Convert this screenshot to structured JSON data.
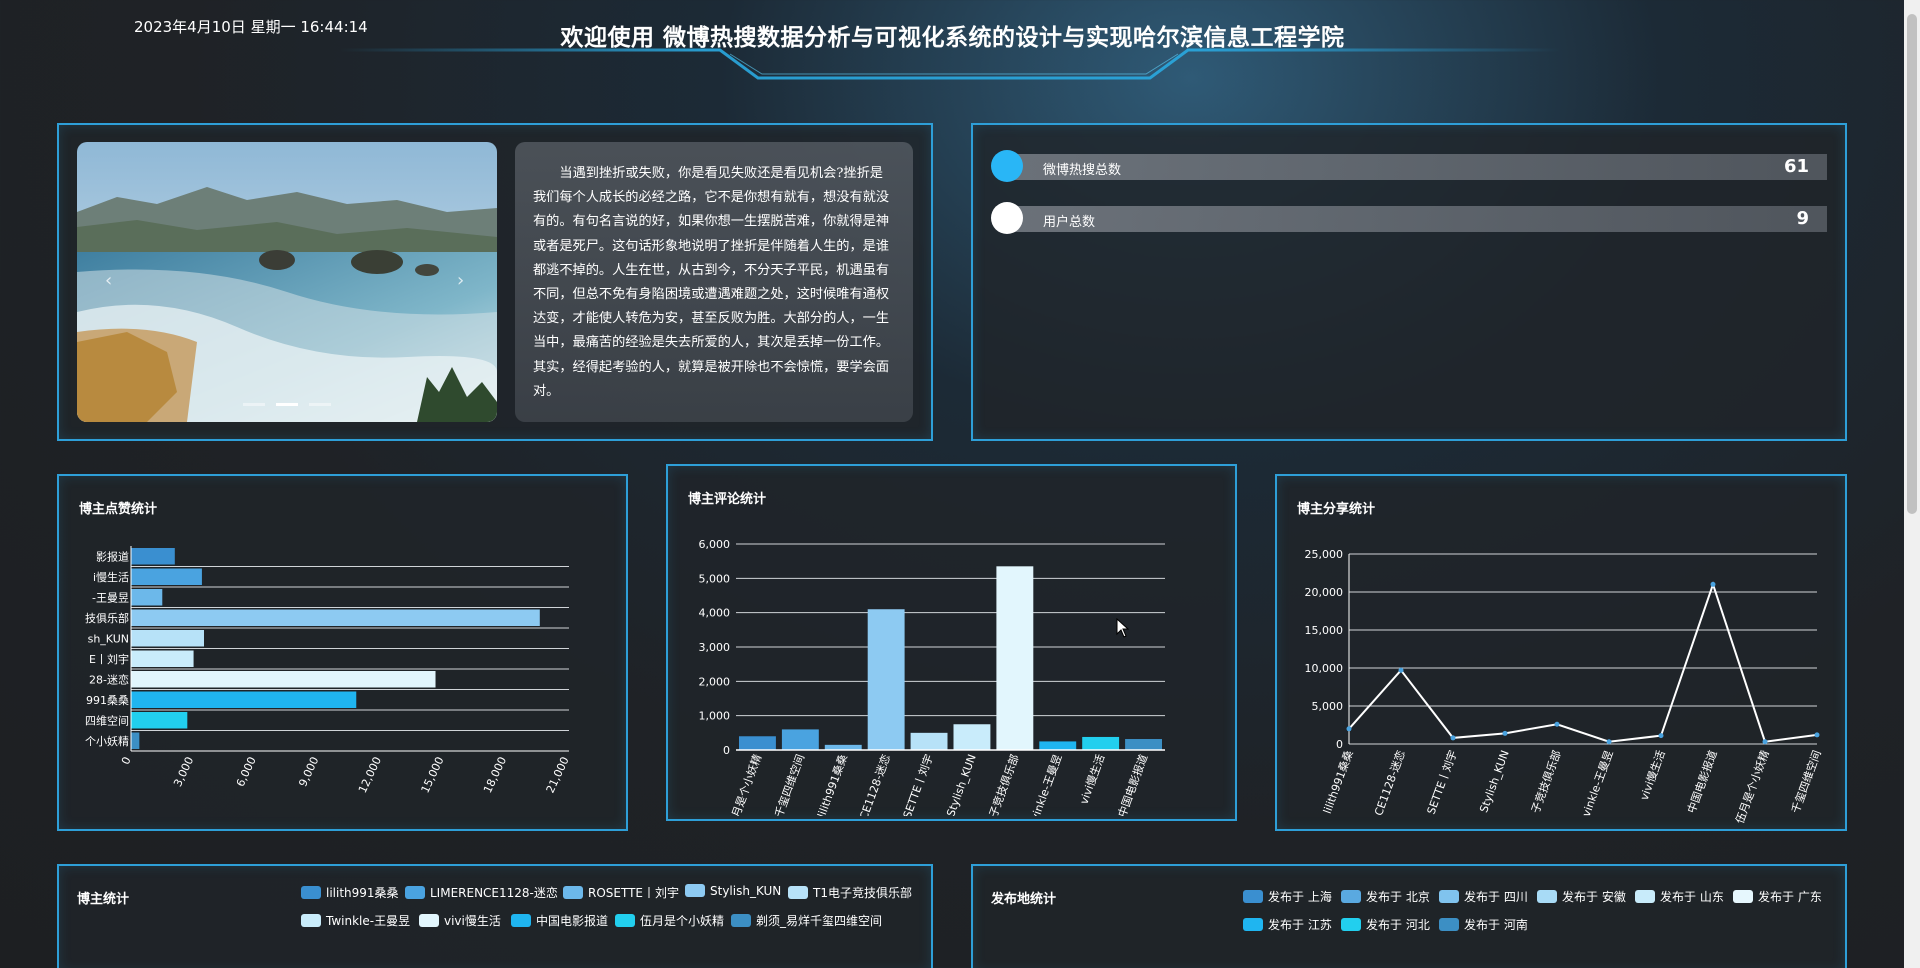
{
  "header": {
    "datetime": "2023年4月10日 星期一 16:44:14",
    "title": "欢迎使用 微博热搜数据分析与可视化系统的设计与实现哈尔滨信息工程学院"
  },
  "quote": {
    "text": "当遇到挫折或失败，你是看见失败还是看见机会?挫折是我们每个人成长的必经之路，它不是你想有就有，想没有就没有的。有句名言说的好，如果你想一生摆脱苦难，你就得是神或者是死尸。这句话形象地说明了挫折是伴随着人生的，是谁都逃不掉的。人生在世，从古到今，不分天子平民，机遇虽有不同，但总不免有身陷困境或遭遇难题之处，这时候唯有通权达变，才能使人转危为安，甚至反败为胜。大部分的人，一生当中，最痛苦的经验是失去所爱的人，其次是丢掉一份工作。其实，经得起考验的人，就算是被开除也不会惊慌，要学会面对。"
  },
  "carousel": {
    "prev_icon": "‹",
    "next_icon": "›"
  },
  "stats": [
    {
      "label": "微博热搜总数",
      "value": "61",
      "color": "#29b6f6"
    },
    {
      "label": "用户总数",
      "value": "9",
      "color": "#ffffff"
    }
  ],
  "panels": {
    "likes_title": "博主点赞统计",
    "comments_title": "博主评论统计",
    "shares_title": "博主分享统计",
    "blogger_title": "博主统计",
    "region_title": "发布地统计"
  },
  "chart_data": [
    {
      "type": "bar",
      "orientation": "horizontal",
      "title": "博主点赞统计",
      "categories": [
        "中国电影报道",
        "vivi慢生活",
        "Twinkle-王曼昱",
        "T1电子竞技俱乐部",
        "Stylish_KUN",
        "ROSETTE丨刘宇",
        "LIMERENCE1128-迷恋",
        "lilith991桑桑",
        "剃须_易烊千玺四维空间",
        "伍月是个小妖精"
      ],
      "tick_labels": [
        "影报道",
        "i慢生活",
        "-王曼昱",
        "技俱乐部",
        "sh_KUN",
        "E丨刘宇",
        "28-迷恋",
        "991桑桑",
        "四维空间",
        "个小妖精"
      ],
      "values": [
        2100,
        3400,
        1500,
        19600,
        3500,
        3000,
        14600,
        10800,
        2700,
        400
      ],
      "xlim": [
        0,
        21000
      ],
      "xticks": [
        "0",
        "3,000",
        "6,000",
        "9,000",
        "12,000",
        "15,000",
        "18,000",
        "21,000"
      ]
    },
    {
      "type": "bar",
      "title": "博主评论统计",
      "categories": [
        "伍月是个小妖精",
        "剃须_易烊千玺四维空间",
        "lilith991桑桑",
        "LIMERENCE1128-迷恋",
        "ROSETTE丨刘宇",
        "Stylish_KUN",
        "T1电子竞技俱乐部",
        "Twinkle-王曼昱",
        "vivi慢生活",
        "中国电影报道"
      ],
      "tick_labels": [
        "伍月是个小妖精",
        "千玺四维空间",
        "lilith991桑桑",
        "CE1128-迷恋",
        "SETTE丨刘宇",
        "Stylish_KUN",
        "子竞技俱乐部",
        "vinkle-王曼昱",
        "vivi慢生活",
        "中国电影报道"
      ],
      "values": [
        400,
        600,
        150,
        4100,
        500,
        750,
        5350,
        250,
        380,
        320
      ],
      "ylim": [
        0,
        6000
      ],
      "yticks": [
        "0",
        "1,000",
        "2,000",
        "3,000",
        "4,000",
        "5,000",
        "6,000"
      ]
    },
    {
      "type": "line",
      "title": "博主分享统计",
      "categories": [
        "lilith991桑桑",
        "LIMERENCE1128-迷恋",
        "ROSETTE丨刘宇",
        "Stylish_KUN",
        "T1电子竞技俱乐部",
        "Twinkle-王曼昱",
        "vivi慢生活",
        "中国电影报道",
        "伍月是个小妖精",
        "剃须_易烊千玺四维空间"
      ],
      "tick_labels": [
        "lilith991桑桑",
        "CE1128-迷恋",
        "SETTE丨刘宇",
        "Stylish_KUN",
        "子竞技俱乐部",
        "vinkle-王曼昱",
        "vivi慢生活",
        "中国电影报道",
        "伍月是个小妖精",
        "千玺四维空间"
      ],
      "values": [
        2000,
        9700,
        800,
        1400,
        2600,
        300,
        1100,
        21000,
        300,
        1200
      ],
      "ylim": [
        0,
        25000
      ],
      "yticks": [
        "0",
        "5,000",
        "10,000",
        "15,000",
        "20,000",
        "25,000"
      ]
    }
  ],
  "blogger_legend": [
    {
      "label": "lilith991桑桑",
      "color": "#3a8fd0"
    },
    {
      "label": "LIMERENCE1128-迷恋",
      "color": "#4aa3e0"
    },
    {
      "label": "ROSETTE丨刘宇",
      "color": "#6cb8ea"
    },
    {
      "label": "Stylish_KUN",
      "color": "#8dcaf2"
    },
    {
      "label": "T1电子竞技俱乐部",
      "color": "#b7e2f8"
    },
    {
      "label": "Twinkle-王曼昱",
      "color": "#c9ecfb"
    },
    {
      "label": "vivi慢生活",
      "color": "#e2f6fd"
    },
    {
      "label": "中国电影报道",
      "color": "#1fb5f0"
    },
    {
      "label": "伍月是个小妖精",
      "color": "#22cfee"
    },
    {
      "label": "剃须_易烊千玺四维空间",
      "color": "#3c8fc4"
    }
  ],
  "region_legend": [
    {
      "label": "发布于 上海",
      "color": "#3a8fd0"
    },
    {
      "label": "发布于 北京",
      "color": "#5aa9e0"
    },
    {
      "label": "发布于 四川",
      "color": "#80c3ee"
    },
    {
      "label": "发布于 安徽",
      "color": "#a8dbf6"
    },
    {
      "label": "发布于 山东",
      "color": "#c8ebfa"
    },
    {
      "label": "发布于 广东",
      "color": "#e6f7fd"
    },
    {
      "label": "发布于 江苏",
      "color": "#1fb5f0"
    },
    {
      "label": "发布于 河北",
      "color": "#22cfee"
    },
    {
      "label": "发布于 河南",
      "color": "#3c8fc4"
    }
  ]
}
